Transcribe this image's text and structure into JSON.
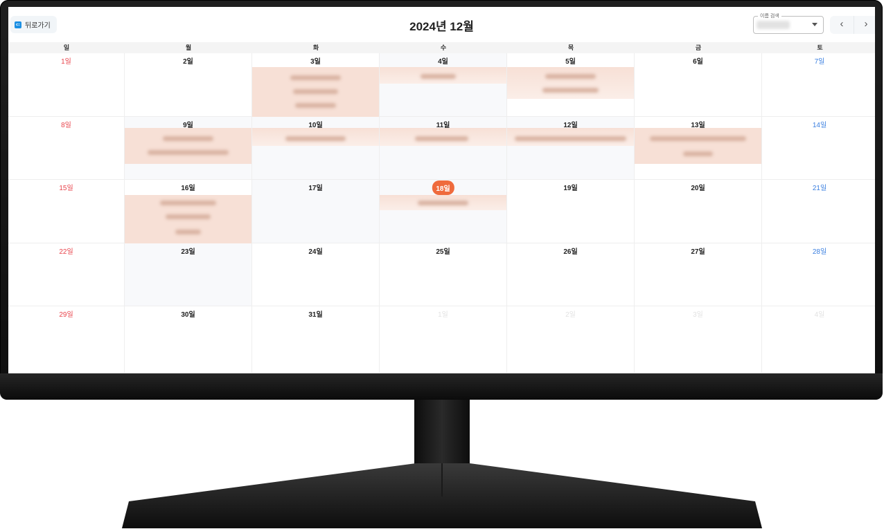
{
  "header": {
    "back_label": "뒤로가기",
    "title": "2024년 12월",
    "search_legend": "이름 검색",
    "prev_icon": "‹",
    "next_icon": "›"
  },
  "weekdays": [
    "일",
    "월",
    "화",
    "수",
    "목",
    "금",
    "토"
  ],
  "weeks": [
    [
      "1일",
      "2일",
      "3일",
      "4일",
      "5일",
      "6일",
      "7일"
    ],
    [
      "8일",
      "9일",
      "10일",
      "11일",
      "12일",
      "13일",
      "14일"
    ],
    [
      "15일",
      "16일",
      "17일",
      "18일",
      "19일",
      "20일",
      "21일"
    ],
    [
      "22일",
      "23일",
      "24일",
      "25일",
      "26일",
      "27일",
      "28일"
    ],
    [
      "29일",
      "30일",
      "31일",
      "1일",
      "2일",
      "3일",
      "4일"
    ]
  ],
  "today": "18일",
  "colors": {
    "sunday": "#e8434b",
    "saturday": "#3a7fe0",
    "today": "#ef6b3d",
    "event": "#f7e0d6",
    "back_icon": "#1a8fe3"
  }
}
